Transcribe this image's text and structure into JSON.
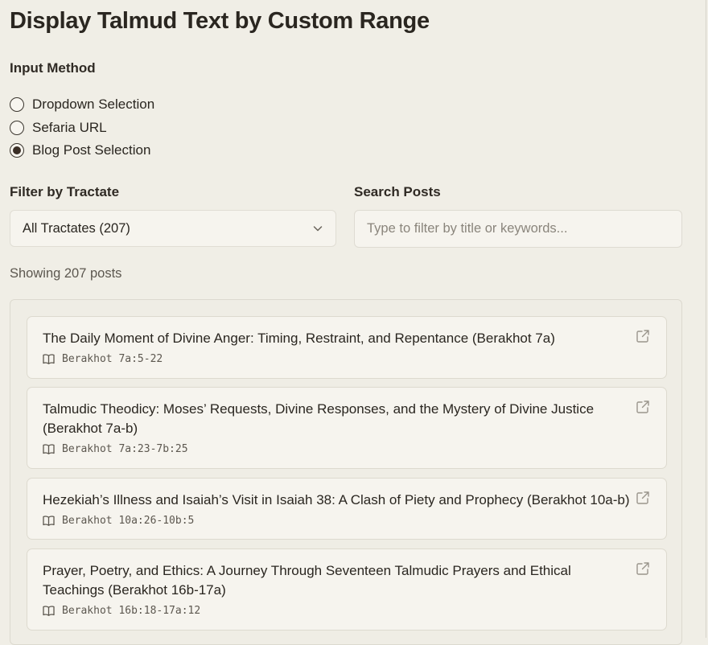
{
  "page": {
    "title": "Display Talmud Text by Custom Range"
  },
  "input_method": {
    "label": "Input Method",
    "options": [
      {
        "label": "Dropdown Selection",
        "selected": false
      },
      {
        "label": "Sefaria URL",
        "selected": false
      },
      {
        "label": "Blog Post Selection",
        "selected": true
      }
    ]
  },
  "filter": {
    "label": "Filter by Tractate",
    "selected": "All Tractates (207)"
  },
  "search": {
    "label": "Search Posts",
    "placeholder": "Type to filter by title or keywords...",
    "value": ""
  },
  "results": {
    "count_text": "Showing 207 posts"
  },
  "posts": [
    {
      "title": "The Daily Moment of Divine Anger: Timing, Restraint, and Repentance (Berakhot 7a)",
      "ref": "Berakhot 7a:5-22"
    },
    {
      "title": "Talmudic Theodicy: Moses’ Requests, Divine Responses, and the Mystery of Divine Justice (Berakhot 7a-b)",
      "ref": "Berakhot 7a:23-7b:25"
    },
    {
      "title": "Hezekiah’s Illness and Isaiah’s Visit in Isaiah 38: A Clash of Piety and Prophecy (Berakhot 10a-b)",
      "ref": "Berakhot 10a:26-10b:5"
    },
    {
      "title": "Prayer, Poetry, and Ethics: A Journey Through Seventeen Talmudic Prayers and Ethical Teachings (Berakhot 16b-17a)",
      "ref": "Berakhot 16b:18-17a:12"
    }
  ],
  "icons": {
    "chevron": "chevron-down-icon",
    "book": "book-icon",
    "external": "external-link-icon"
  },
  "colors": {
    "background": "#f0eee6",
    "card": "#f6f4ee",
    "border": "#dddacf",
    "text": "#2a2620",
    "muted": "#5c574f",
    "icon": "#9a958c"
  }
}
